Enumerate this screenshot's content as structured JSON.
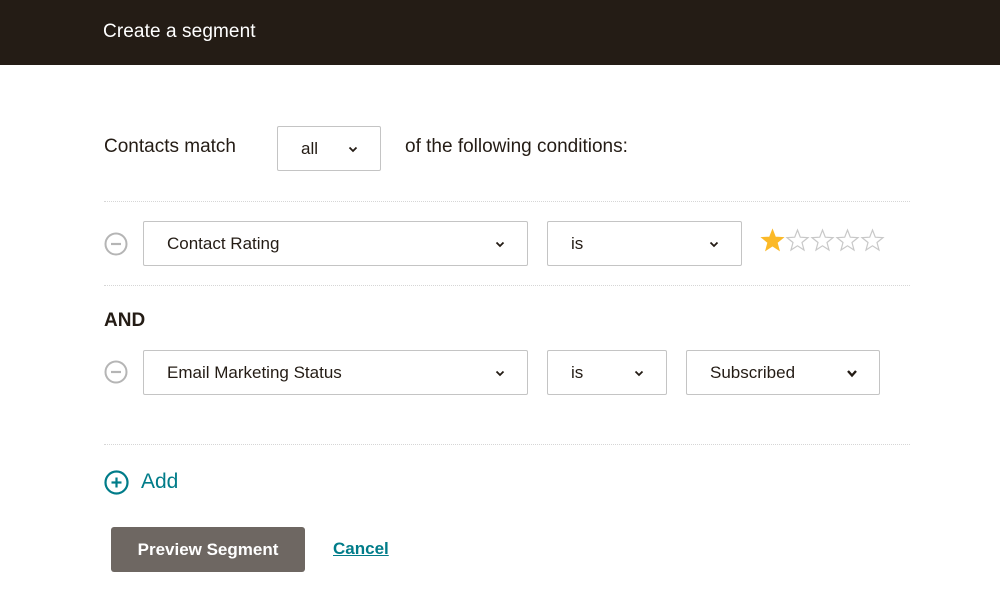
{
  "header": {
    "title": "Create a segment"
  },
  "match": {
    "prefix": "Contacts match",
    "selected": "all",
    "suffix": "of the following conditions:"
  },
  "conditions": [
    {
      "field": "Contact Rating",
      "operator": "is",
      "rating": {
        "value": 1,
        "max": 5
      }
    },
    {
      "field": "Email Marketing Status",
      "operator": "is",
      "value": "Subscribed"
    }
  ],
  "conjunction": "AND",
  "actions": {
    "add_label": "Add",
    "preview_label": "Preview Segment",
    "cancel_label": "Cancel"
  },
  "colors": {
    "header_bg": "#241c15",
    "accent": "#007c89",
    "star_filled": "#fbb928",
    "star_empty": "#c8c8c8",
    "button_bg": "#6e6762"
  },
  "icons": {
    "remove": "minus-circle-icon",
    "chevron": "chevron-down-icon",
    "add": "plus-circle-icon",
    "star": "star-icon"
  }
}
